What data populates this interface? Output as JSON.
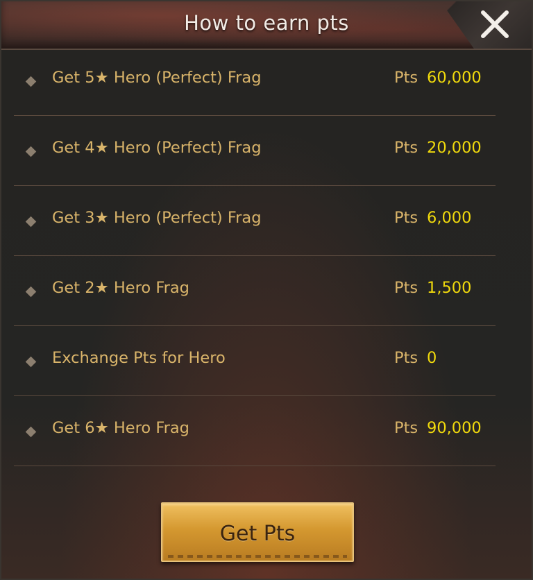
{
  "header": {
    "title": "How to earn pts",
    "close_icon": "close-icon"
  },
  "colors": {
    "label": "#d9b46a",
    "value": "#f1da0c",
    "button": "#d49830"
  },
  "rows": [
    {
      "label": "Get 5★ Hero (Perfect) Frag",
      "pts_label": "Pts",
      "value": "60,000"
    },
    {
      "label": "Get 4★ Hero (Perfect) Frag",
      "pts_label": "Pts",
      "value": "20,000"
    },
    {
      "label": "Get 3★ Hero (Perfect) Frag",
      "pts_label": "Pts",
      "value": "6,000"
    },
    {
      "label": "Get 2★ Hero Frag",
      "pts_label": "Pts",
      "value": "1,500"
    },
    {
      "label": "Exchange Pts for Hero",
      "pts_label": "Pts",
      "value": "0"
    },
    {
      "label": "Get 6★ Hero Frag",
      "pts_label": "Pts",
      "value": "90,000"
    }
  ],
  "footer": {
    "button_label": "Get Pts"
  }
}
